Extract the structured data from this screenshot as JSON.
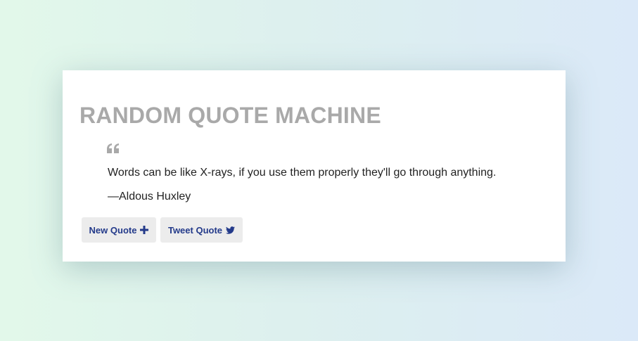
{
  "app": {
    "title": "RANDOM QUOTE MACHINE"
  },
  "quote": {
    "icon": "quote-left-icon",
    "text": "Words can be like X-rays, if you use them properly they'll go through anything.",
    "author": "—Aldous Huxley"
  },
  "buttons": {
    "new_quote": {
      "label": "New Quote",
      "icon": "plus-icon"
    },
    "tweet_quote": {
      "label": "Tweet Quote",
      "icon": "twitter-icon"
    }
  },
  "colors": {
    "title": "#a9a9a9",
    "button_text": "#233a8a",
    "button_bg": "#ececec",
    "quote_icon": "#a9a9a9"
  }
}
